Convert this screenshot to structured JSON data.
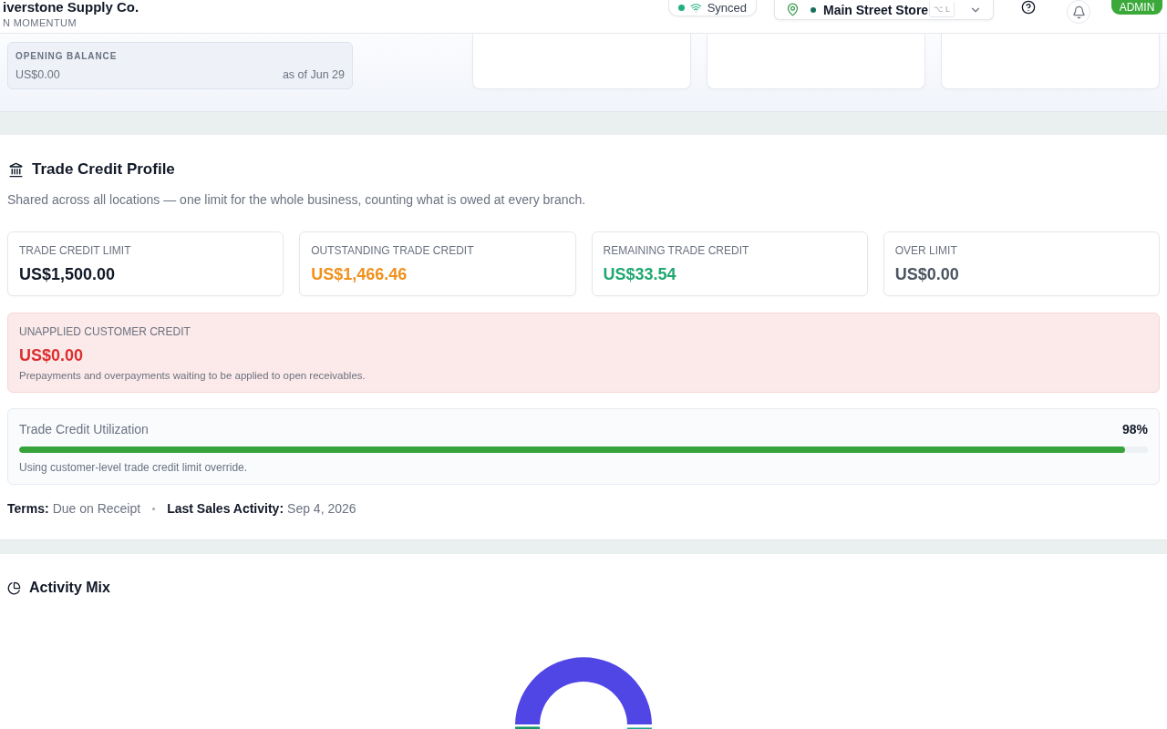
{
  "header": {
    "company": "iverstone Supply Co.",
    "tagline": "N MOMENTUM",
    "sync": {
      "label": "Synced"
    },
    "location": {
      "name": "Main Street Store",
      "shortcut": "⌥ L"
    },
    "role_badge": "ADMIN"
  },
  "opening_balance": {
    "label": "OPENING BALANCE",
    "amount": "US$0.00",
    "as_of": "as of Jun 29"
  },
  "trade_credit_profile": {
    "title": "Trade Credit Profile",
    "description": "Shared across all locations — one limit for the whole business, counting what is owed at every branch.",
    "stats": [
      {
        "label": "TRADE CREDIT LIMIT",
        "value": "US$1,500.00",
        "color": "#111827"
      },
      {
        "label": "OUTSTANDING TRADE CREDIT",
        "value": "US$1,466.46",
        "color": "#f0911c"
      },
      {
        "label": "REMAINING TRADE CREDIT",
        "value": "US$33.54",
        "color": "#21a872"
      },
      {
        "label": "OVER LIMIT",
        "value": "US$0.00",
        "color": "#4b5563"
      }
    ],
    "unapplied": {
      "label": "UNAPPLIED CUSTOMER CREDIT",
      "value": "US$0.00",
      "note": "Prepayments and overpayments waiting to be applied to open receivables."
    },
    "utilization": {
      "title": "Trade Credit Utilization",
      "percent": "98%",
      "level": 0.98,
      "note": "Using customer-level trade credit limit override."
    },
    "details": [
      {
        "label": "Terms:",
        "value": "Due on Receipt"
      },
      {
        "label": "Last Sales Activity:",
        "value": "Sep 4, 2026"
      }
    ]
  },
  "activity_mix": {
    "title": "Activity Mix"
  }
}
